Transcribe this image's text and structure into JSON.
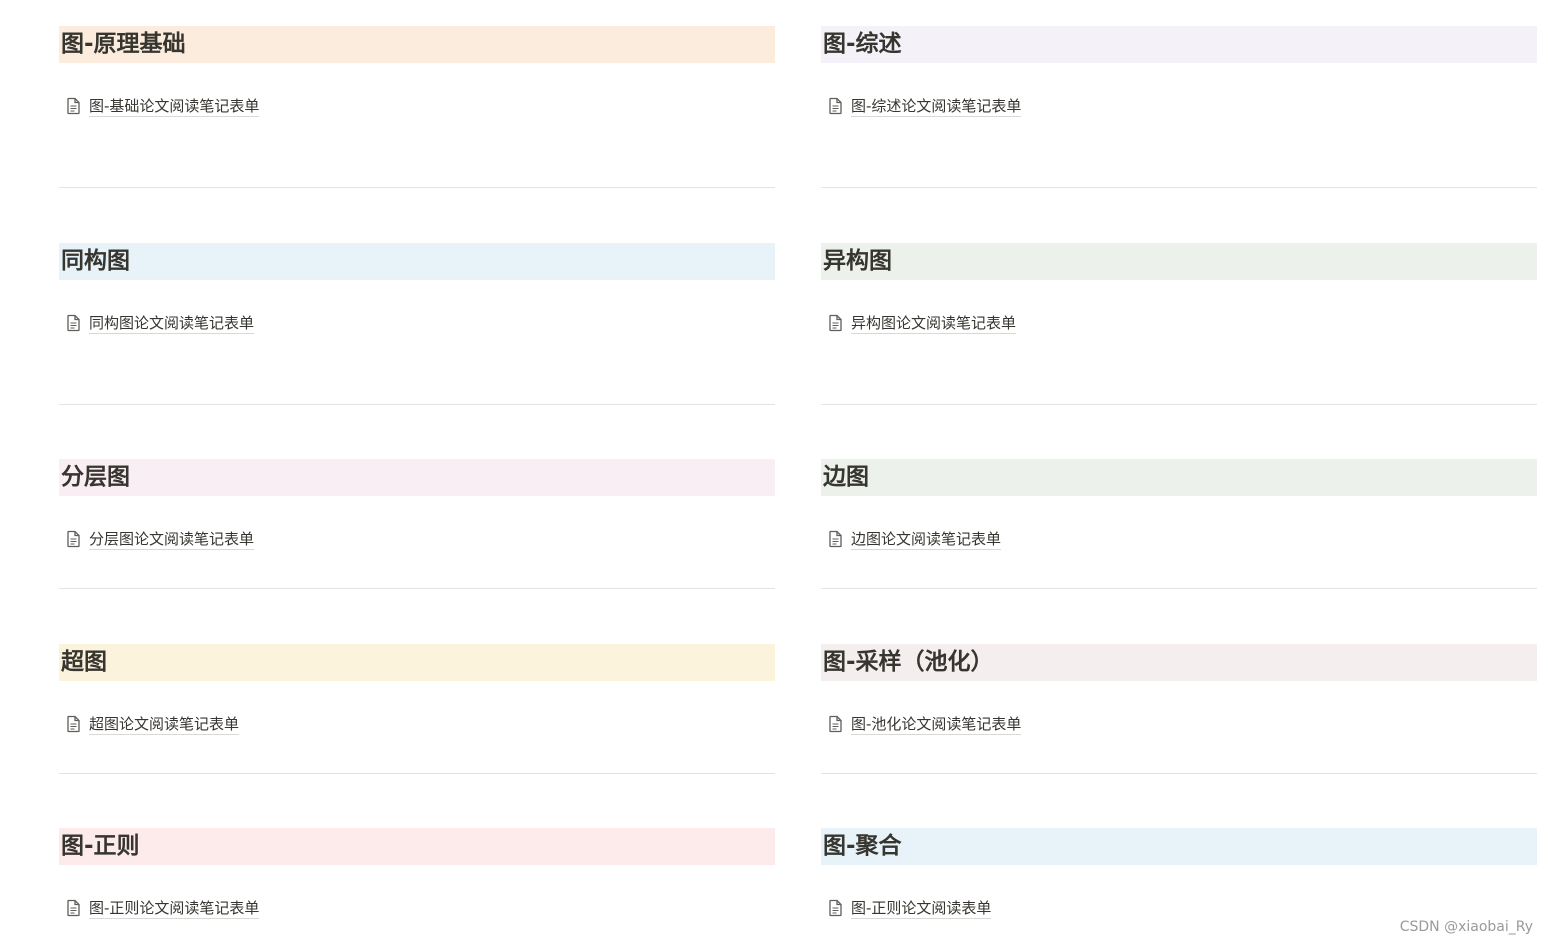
{
  "sections": [
    {
      "heading": "图-原理基础",
      "link": "图-基础论文阅读笔记表单",
      "color": "#fbecdd"
    },
    {
      "heading": "图-综述",
      "link": "图-综述论文阅读笔记表单",
      "color": "#f4f2f8"
    },
    {
      "heading": "同构图",
      "link": "同构图论文阅读笔记表单",
      "color": "#e7f3f8"
    },
    {
      "heading": "异构图",
      "link": "异构图论文阅读笔记表单",
      "color": "#edf1ec"
    },
    {
      "heading": "分层图",
      "link": "分层图论文阅读笔记表单",
      "color": "#f9eef3"
    },
    {
      "heading": "边图",
      "link": "边图论文阅读笔记表单",
      "color": "#edf1ec"
    },
    {
      "heading": "超图",
      "link": "超图论文阅读笔记表单",
      "color": "#fbf3db"
    },
    {
      "heading": "图-采样（池化）",
      "link": "图-池化论文阅读笔记表单",
      "color": "#f4eeee"
    },
    {
      "heading": "图-正则",
      "link": "图-正则论文阅读笔记表单",
      "color": "#fdebec"
    },
    {
      "heading": "图-聚合",
      "link": "图-正则论文阅读表单",
      "color": "#e7f3f8"
    }
  ],
  "watermark": "CSDN @xiaobai_Ry",
  "icons": {
    "page": "document-icon"
  }
}
